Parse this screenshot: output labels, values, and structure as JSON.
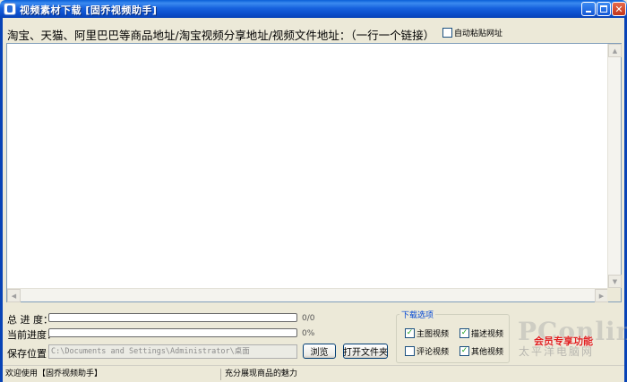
{
  "window": {
    "title": "视频素材下载 [固乔视频助手]",
    "icon": "app-icon",
    "controls": [
      "minimize-icon",
      "maximize-icon",
      "close-icon"
    ]
  },
  "header": {
    "instruction": "淘宝、天猫、阿里巴巴等商品地址/淘宝视频分享地址/视频文件地址：（一行一个链接）",
    "auto_paste_label": "自动粘贴网址",
    "auto_paste_checked": false
  },
  "url_input": {
    "value": ""
  },
  "progress": {
    "total_label": "总 进 度：",
    "total_text": "0/0",
    "total_fraction": 0,
    "current_label": "当前进度：",
    "current_text": "0%",
    "current_fraction": 0
  },
  "save": {
    "label": "保存位置：",
    "path": "C:\\Documents and Settings\\Administrator\\桌面",
    "browse_button": "浏览",
    "open_folder_button": "打开文件夹"
  },
  "download_options": {
    "legend": "下载选项",
    "options": [
      {
        "label": "主图视频",
        "checked": true
      },
      {
        "label": "描述视频",
        "checked": true
      },
      {
        "label": "评论视频",
        "checked": false
      },
      {
        "label": "其他视频",
        "checked": true
      }
    ]
  },
  "vip_text": "会员专享功能",
  "watermark": {
    "logo": "PConline",
    "sub": "太平洋电脑网"
  },
  "status": {
    "left": "欢迎使用【固乔视频助手】",
    "right": "充分展现商品的魅力"
  },
  "colors": {
    "titlebar": "#0A4CC9",
    "window_bg": "#ECE9D8",
    "check_mark": "#21A121",
    "vip_red": "#E02020",
    "legend_blue": "#0046D5"
  }
}
